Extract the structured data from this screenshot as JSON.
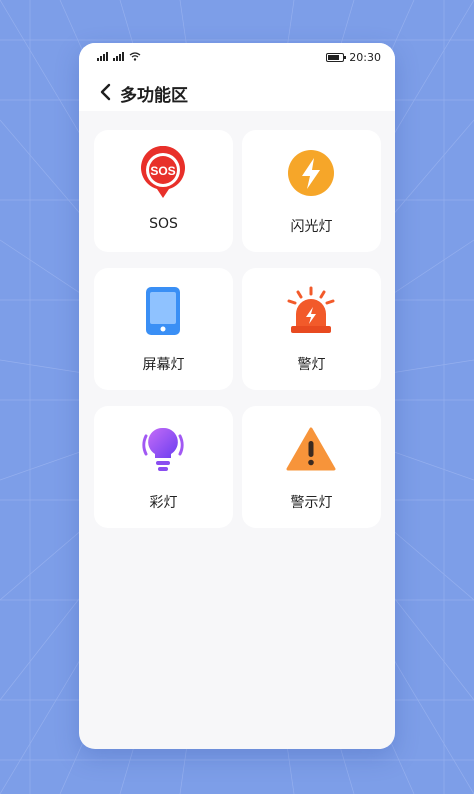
{
  "statusbar": {
    "time": "20:30",
    "battery_level": 0.8,
    "icons": [
      "signal-icon",
      "signal-icon",
      "wifi-icon",
      "battery-icon"
    ]
  },
  "header": {
    "title": "多功能区",
    "back_icon": "chevron-left-icon"
  },
  "features": [
    {
      "label": "SOS",
      "icon": "sos-icon",
      "color": "#e8302a"
    },
    {
      "label": "闪光灯",
      "icon": "flash-icon",
      "color": "#f6a629"
    },
    {
      "label": "屏幕灯",
      "icon": "phone-screen-icon",
      "color": "#3a8ff5"
    },
    {
      "label": "警灯",
      "icon": "alarm-light-icon",
      "color": "#f25a2a"
    },
    {
      "label": "彩灯",
      "icon": "colorful-bulb-icon",
      "color": "#8a4df0"
    },
    {
      "label": "警示灯",
      "icon": "warning-icon",
      "color": "#f7943a"
    }
  ],
  "colors": {
    "background": "#7d9ee8",
    "card": "#ffffff",
    "screen": "#f7f7f9"
  }
}
